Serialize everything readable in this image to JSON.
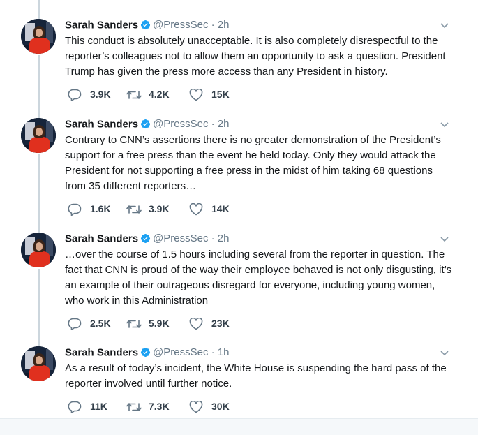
{
  "tweets": [
    {
      "author": "Sarah Sanders",
      "handle": "@PressSec · 2h",
      "text": "This conduct is absolutely unacceptable. It is also completely disrespectful to the reporter’s colleagues not to allow them an opportunity to ask a question. President Trump has given the press more access than any President in history.",
      "replies": "3.9K",
      "retweets": "4.2K",
      "likes": "15K"
    },
    {
      "author": "Sarah Sanders",
      "handle": "@PressSec · 2h",
      "text": "Contrary to CNN’s assertions there is no greater demonstration of the President’s support for a free press than the event he held today. Only they would attack the President for not supporting a free press in the midst of him taking 68 questions from 35 different reporters…",
      "replies": "1.6K",
      "retweets": "3.9K",
      "likes": "14K"
    },
    {
      "author": "Sarah Sanders",
      "handle": "@PressSec · 2h",
      "text": "…over the course of 1.5 hours including several from the reporter in question. The fact that CNN is proud of the way their employee behaved is not only disgusting, it’s an example of their outrageous disregard for everyone, including young women, who work in this Administration",
      "replies": "2.5K",
      "retweets": "5.9K",
      "likes": "23K"
    },
    {
      "author": "Sarah Sanders",
      "handle": "@PressSec · 1h",
      "text": "As a result of today’s incident, the White House is suspending the hard pass of the reporter involved until further notice.",
      "replies": "11K",
      "retweets": "7.3K",
      "likes": "30K"
    }
  ],
  "icons": {
    "verified": "verified-badge-icon",
    "reply": "reply-icon",
    "retweet": "retweet-icon",
    "like": "heart-icon",
    "menu": "chevron-down-icon"
  },
  "colors": {
    "verified": "#1da1f2",
    "text": "#14171a",
    "secondary": "#657786",
    "thread_line": "#ccd6dd"
  }
}
